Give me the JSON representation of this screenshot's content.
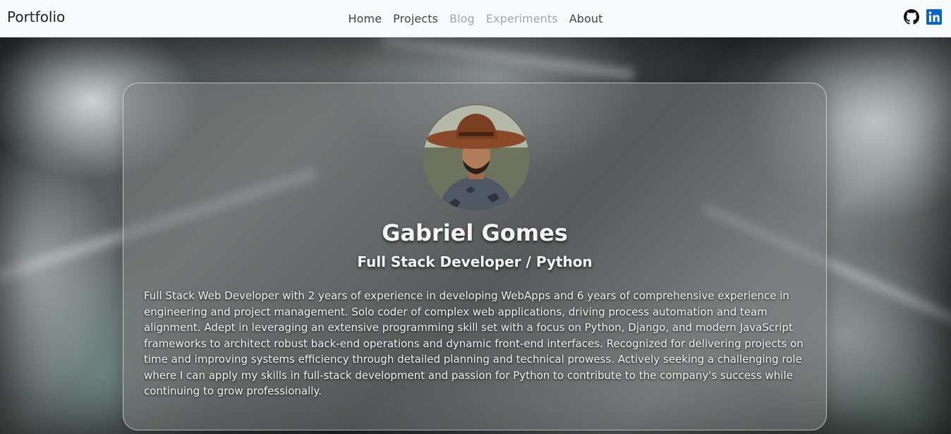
{
  "navbar": {
    "brand": "Portfolio",
    "links": [
      {
        "label": "Home",
        "state": "active"
      },
      {
        "label": "Projects",
        "state": "active"
      },
      {
        "label": "Blog",
        "state": "disabled"
      },
      {
        "label": "Experiments",
        "state": "disabled"
      },
      {
        "label": "About",
        "state": "active"
      }
    ],
    "socials": [
      {
        "icon": "github-icon"
      },
      {
        "icon": "linkedin-icon",
        "color": "#0a66c2"
      }
    ]
  },
  "profile": {
    "name": "Gabriel Gomes",
    "role": "Full Stack Developer / Python",
    "bio": "Full Stack Web Developer with 2 years of experience in developing WebApps and 6 years of comprehensive experience in engineering and project management. Solo coder of complex web applications, driving process automation and team alignment. Adept in leveraging an extensive programming skill set with a focus on Python, Django, and modern JavaScript frameworks to architect robust back-end operations and dynamic front-end interfaces. Recognized for delivering projects on time and improving systems efficiency through detailed planning and technical prowess. Actively seeking a challenging role where I can apply my skills in full-stack development and passion for Python to contribute to the company's success while continuing to grow professionally."
  }
}
